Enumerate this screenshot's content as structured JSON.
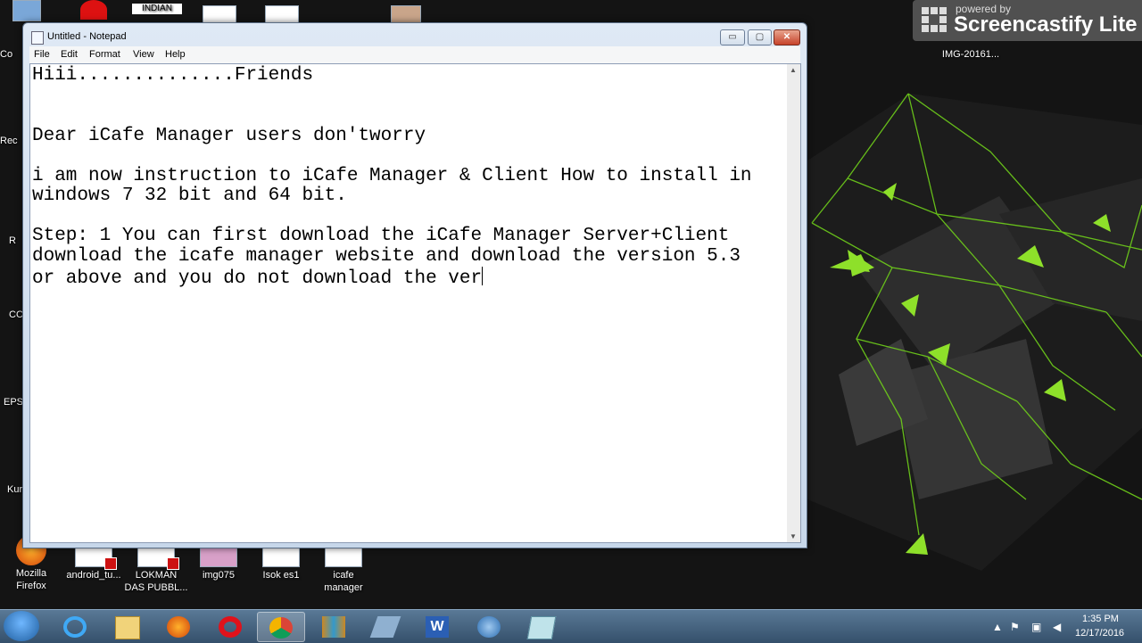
{
  "window": {
    "title": "Untitled - Notepad",
    "minimize_glyph": "▭",
    "maximize_glyph": "▢",
    "close_glyph": "✕"
  },
  "menu": {
    "file": "File",
    "edit": "Edit",
    "format": "Format",
    "view": "View",
    "help": "Help"
  },
  "document": {
    "lines": [
      "Hiii..............Friends",
      "",
      "",
      "Dear iCafe Manager users don'tworry",
      "",
      "i am now instruction to iCafe Manager & Client How to install in",
      "windows 7 32 bit and 64 bit.",
      "",
      "Step: 1 You can first download the iCafe Manager Server+Client",
      "download the icafe manager website and download the version 5.3",
      "or above and you do not download the ver"
    ]
  },
  "screencastify": {
    "powered": "powered by",
    "name": "Screencastify Lite"
  },
  "desktop": {
    "top_icon_label": "INDIAN",
    "right_icon_label": "IMG-20161...",
    "left_edge_labels": [
      "Co",
      "Rec",
      "R",
      "CC",
      "EPS",
      "Kur"
    ],
    "bottom_icons": [
      {
        "label": "Mozilla\nFirefox",
        "icon": "firefox-icon"
      },
      {
        "label": "android_tu...",
        "icon": "pdf-file-icon"
      },
      {
        "label": "LOKMAN\nDAS PUBBL...",
        "icon": "pdf-file-icon"
      },
      {
        "label": "img075",
        "icon": "image-file-icon"
      },
      {
        "label": "Isok es1",
        "icon": "document-file-icon"
      },
      {
        "label": "icafe\nmanager",
        "icon": "document-file-icon"
      }
    ]
  },
  "taskbar": {
    "pinned": [
      "internet-explorer-icon",
      "explorer-folder-icon",
      "firefox-icon",
      "opera-icon",
      "chrome-icon",
      "winrar-icon",
      "network-icon",
      "word-icon",
      "globe-settings-icon",
      "notepad-icon"
    ],
    "clock_time": "1:35 PM",
    "clock_date": "12/17/2016",
    "tray_icons": [
      "show-hidden-icon",
      "action-center-icon",
      "network-status-icon",
      "volume-icon"
    ]
  },
  "colors": {
    "accent": "#7fd11b",
    "desktop_bg": "#141414",
    "taskbar": "#4a6782"
  }
}
